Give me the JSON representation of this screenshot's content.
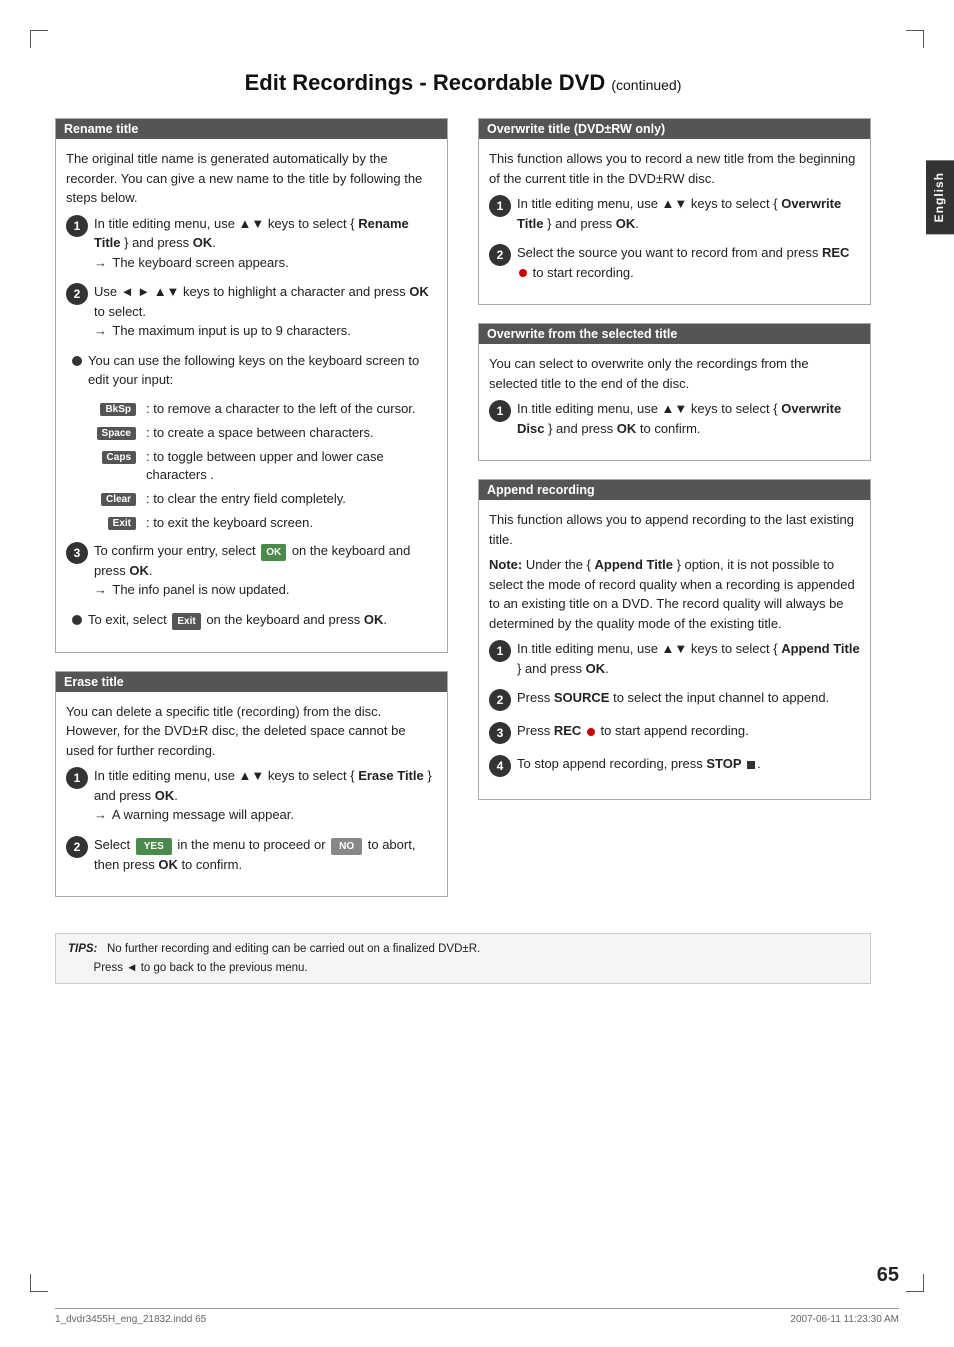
{
  "page": {
    "title": "Edit Recordings - Recordable DVD",
    "title_suffix": "(continued)",
    "page_number": "65",
    "side_tab": "English"
  },
  "footer": {
    "left": "1_dvdr3455H_eng_21832.indd  65",
    "right": "2007-06-11   11:23:30 AM"
  },
  "tips": {
    "label": "TIPS:",
    "lines": [
      "No further recording and editing can be carried out on a finalized DVD±R.",
      "Press ◄ to go back to the previous menu."
    ]
  },
  "left_column": {
    "rename_title": {
      "header": "Rename title",
      "intro": "The original title name is generated automatically by the recorder. You can give a new name to the title by following the steps below.",
      "steps": [
        {
          "num": "1",
          "text": "In title editing menu, use ▲▼ keys to select { Rename Title } and press OK.",
          "arrow": "→ The keyboard screen appears."
        },
        {
          "num": "2",
          "text": "Use ◄ ► ▲▼ keys to highlight a character and press OK to select.",
          "arrow": "→ The maximum input is up to 9 characters."
        },
        {
          "bullet": true,
          "text": "You can use the following keys on the keyboard screen to edit your input:"
        }
      ],
      "keys": [
        {
          "key": "BkSp",
          "desc": ": to remove a character to the left of the cursor."
        },
        {
          "key": "Space",
          "desc": ": to create a space between characters."
        },
        {
          "key": "Caps",
          "desc": ": to toggle between upper and lower case characters ."
        },
        {
          "key": "Clear",
          "desc": ": to clear the entry field completely."
        },
        {
          "key": "Exit",
          "desc": ": to exit the keyboard screen."
        }
      ],
      "steps2": [
        {
          "num": "3",
          "text": "To confirm your entry, select OK on the keyboard and press OK.",
          "arrow": "→ The info panel is now updated."
        },
        {
          "bullet": true,
          "text": "To exit, select Exit on the keyboard and press OK."
        }
      ]
    },
    "erase_title": {
      "header": "Erase title",
      "intro": "You can delete a specific title (recording) from the disc. However, for the DVD±R disc, the deleted space cannot be used for further recording.",
      "steps": [
        {
          "num": "1",
          "text": "In title editing menu, use ▲▼ keys to select { Erase Title } and press OK.",
          "arrow": "→ A warning message will appear."
        },
        {
          "num": "2",
          "text_parts": [
            "Select ",
            "YES",
            " in the menu to proceed or ",
            "NO",
            " to abort, then press OK to confirm."
          ]
        }
      ]
    }
  },
  "right_column": {
    "overwrite_title": {
      "header": "Overwrite title (DVD±RW only)",
      "intro": "This function allows you to record a new title from the beginning of the current title in the DVD±RW disc.",
      "steps": [
        {
          "num": "1",
          "text": "In title editing menu, use ▲▼ keys to select { Overwrite Title } and press OK."
        },
        {
          "num": "2",
          "text": "Select the source you want to record from and press REC ● to start recording."
        }
      ]
    },
    "overwrite_selected": {
      "header": "Overwrite from the selected title",
      "intro": "You can select to overwrite only the recordings from the selected title to the end of the disc.",
      "steps": [
        {
          "num": "1",
          "text": "In title editing menu, use ▲▼ keys to select { Overwrite Disc } and press OK to confirm."
        }
      ]
    },
    "append_recording": {
      "header": "Append recording",
      "intro": "This function allows you to append recording to the last existing title.",
      "note": "Note: Under the { Append Title } option, it is not possible to select the mode of record quality when a recording is appended to an existing title on a DVD. The record quality will always be determined by the quality mode of the existing title.",
      "steps": [
        {
          "num": "1",
          "text": "In title editing menu, use ▲▼ keys to select { Append Title } and press OK."
        },
        {
          "num": "2",
          "text": "Press SOURCE to select the input channel to append."
        },
        {
          "num": "3",
          "text": "Press REC ● to start append recording."
        },
        {
          "num": "4",
          "text": "To stop append recording, press STOP ■."
        }
      ]
    }
  }
}
